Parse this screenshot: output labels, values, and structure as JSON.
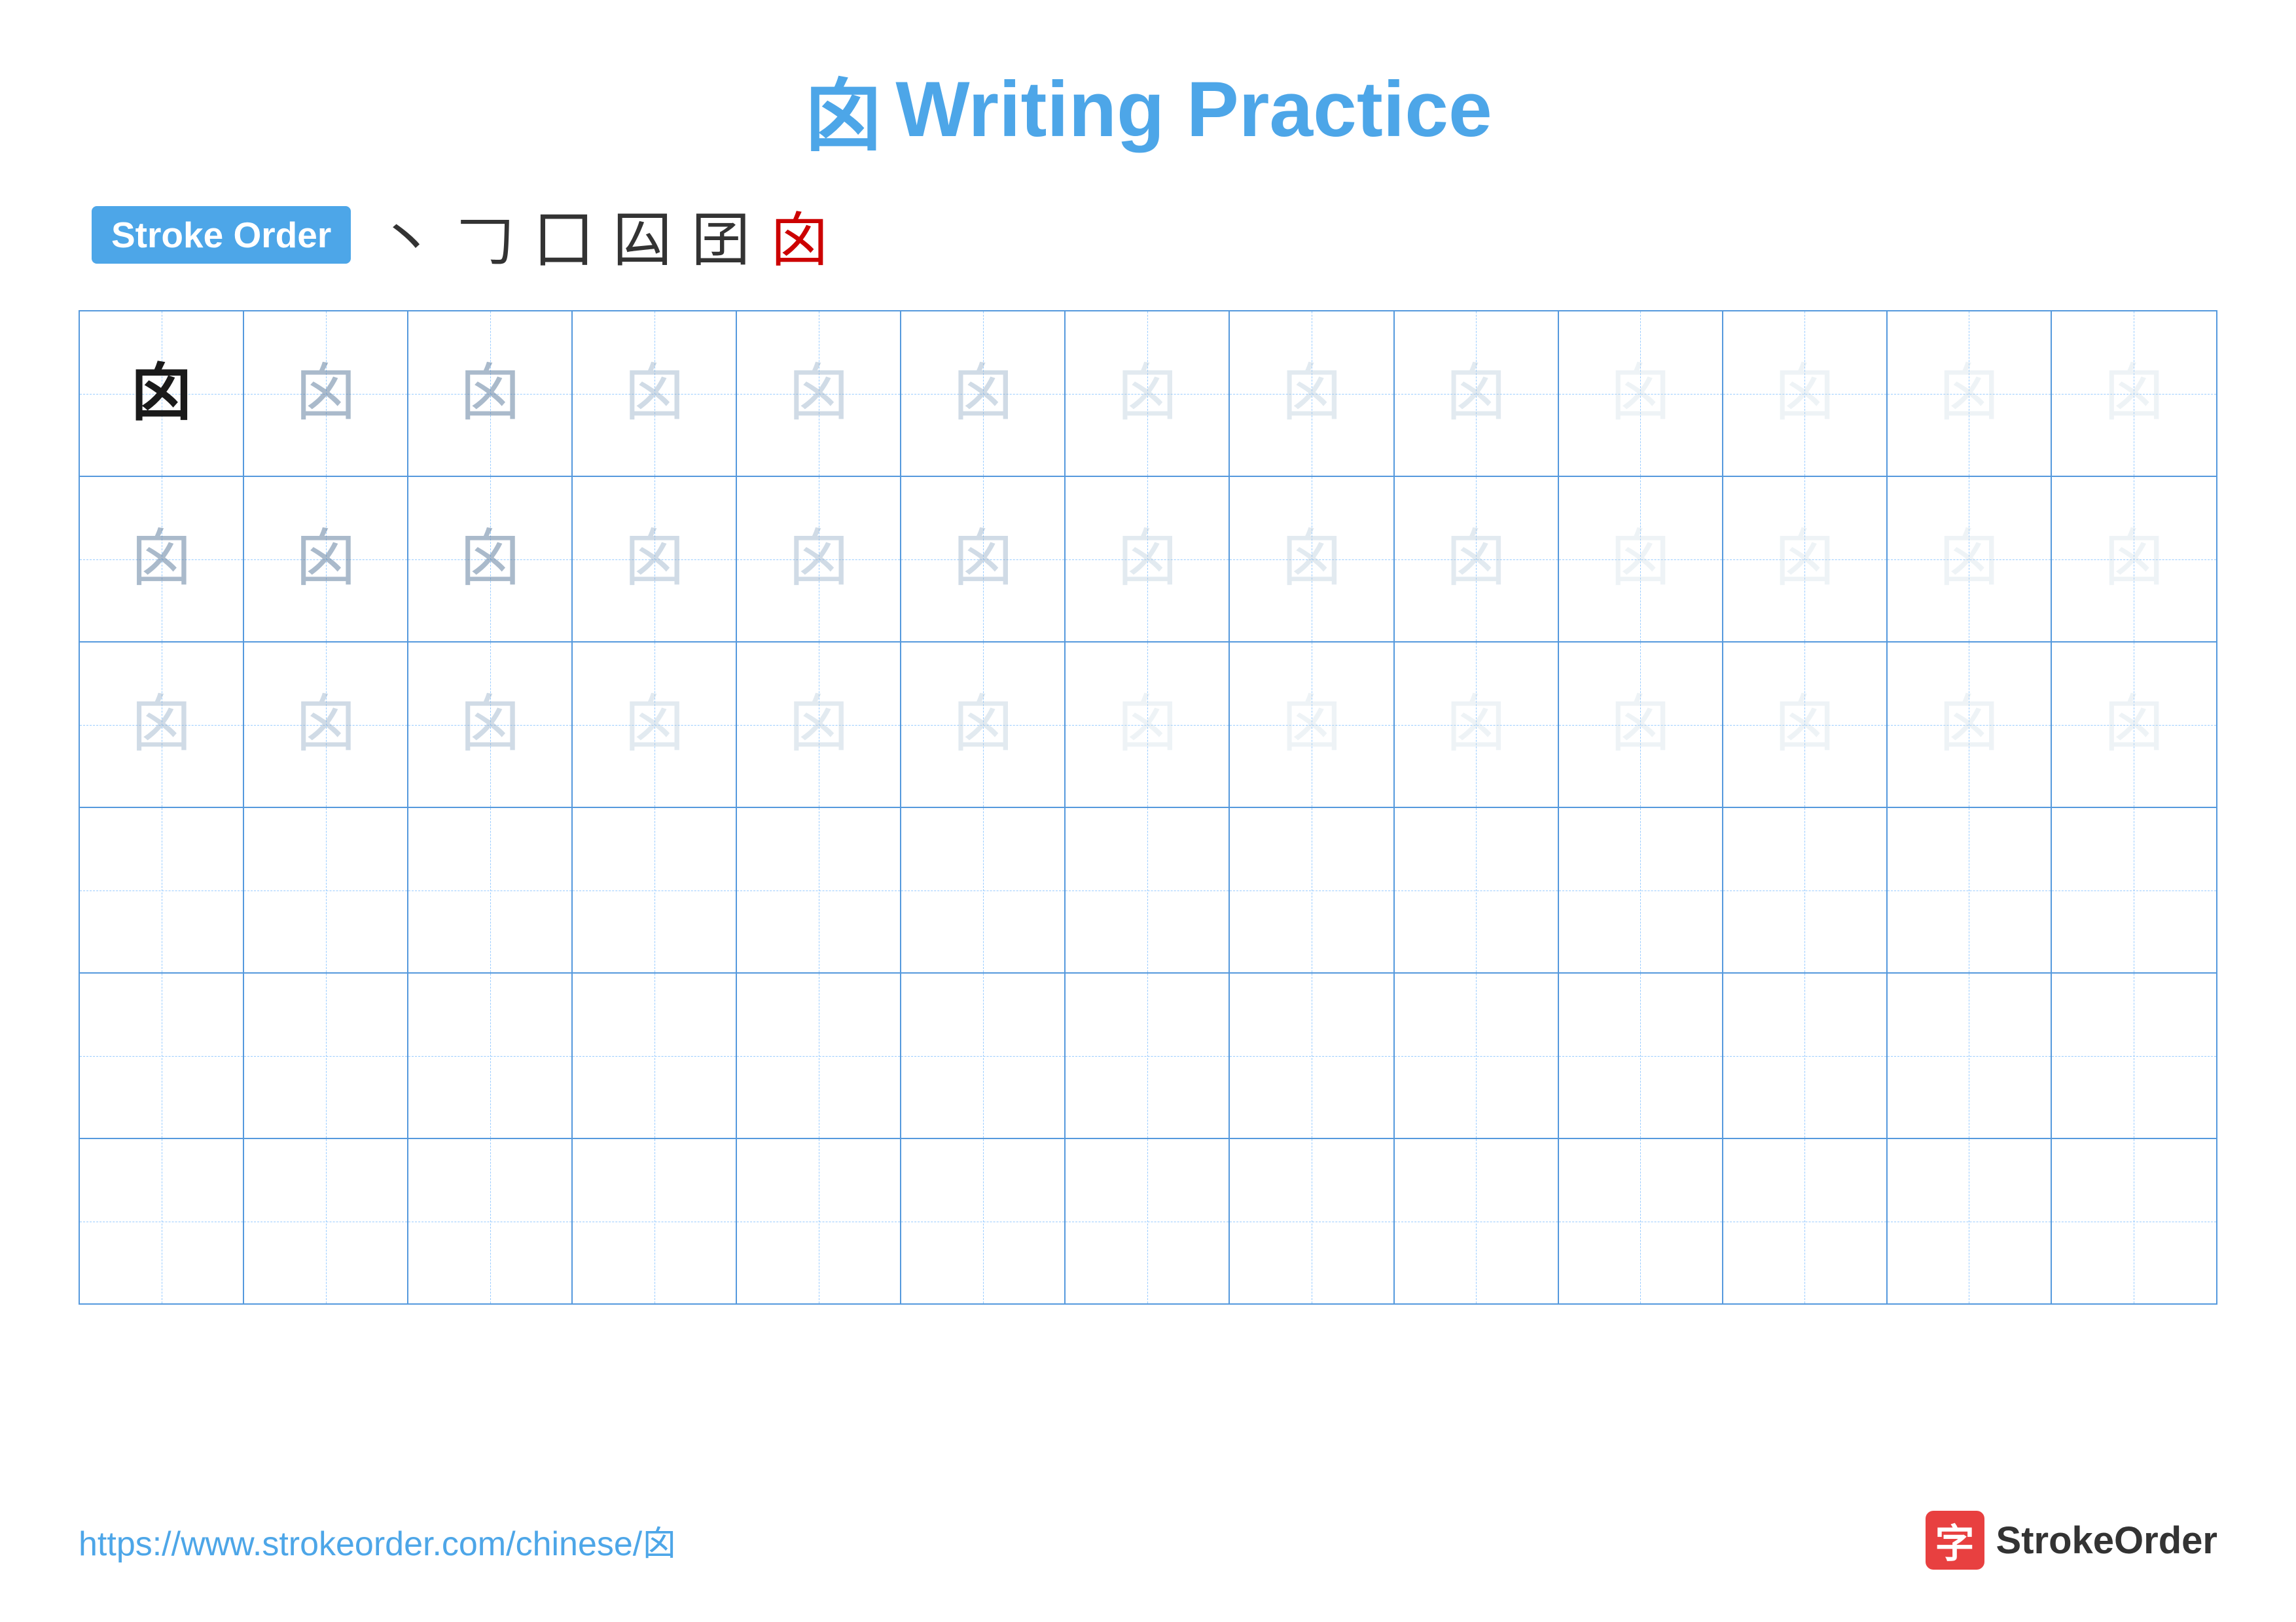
{
  "header": {
    "title_char": "囟",
    "title_text": "Writing Practice",
    "stroke_order_label": "Stroke Order"
  },
  "stroke_sequence": {
    "strokes": [
      "丶",
      "𠃌",
      "囗",
      "囜",
      "囝",
      "囟"
    ]
  },
  "grid": {
    "rows": 6,
    "cols": 13,
    "char": "囟",
    "row_1_pattern": "dark+light",
    "row_2_pattern": "light",
    "row_3_pattern": "lighter",
    "row_4_pattern": "empty",
    "row_5_pattern": "empty",
    "row_6_pattern": "empty"
  },
  "footer": {
    "url": "https://www.strokeorder.com/chinese/囟",
    "logo_icon": "字",
    "logo_text": "StrokeOrder"
  }
}
